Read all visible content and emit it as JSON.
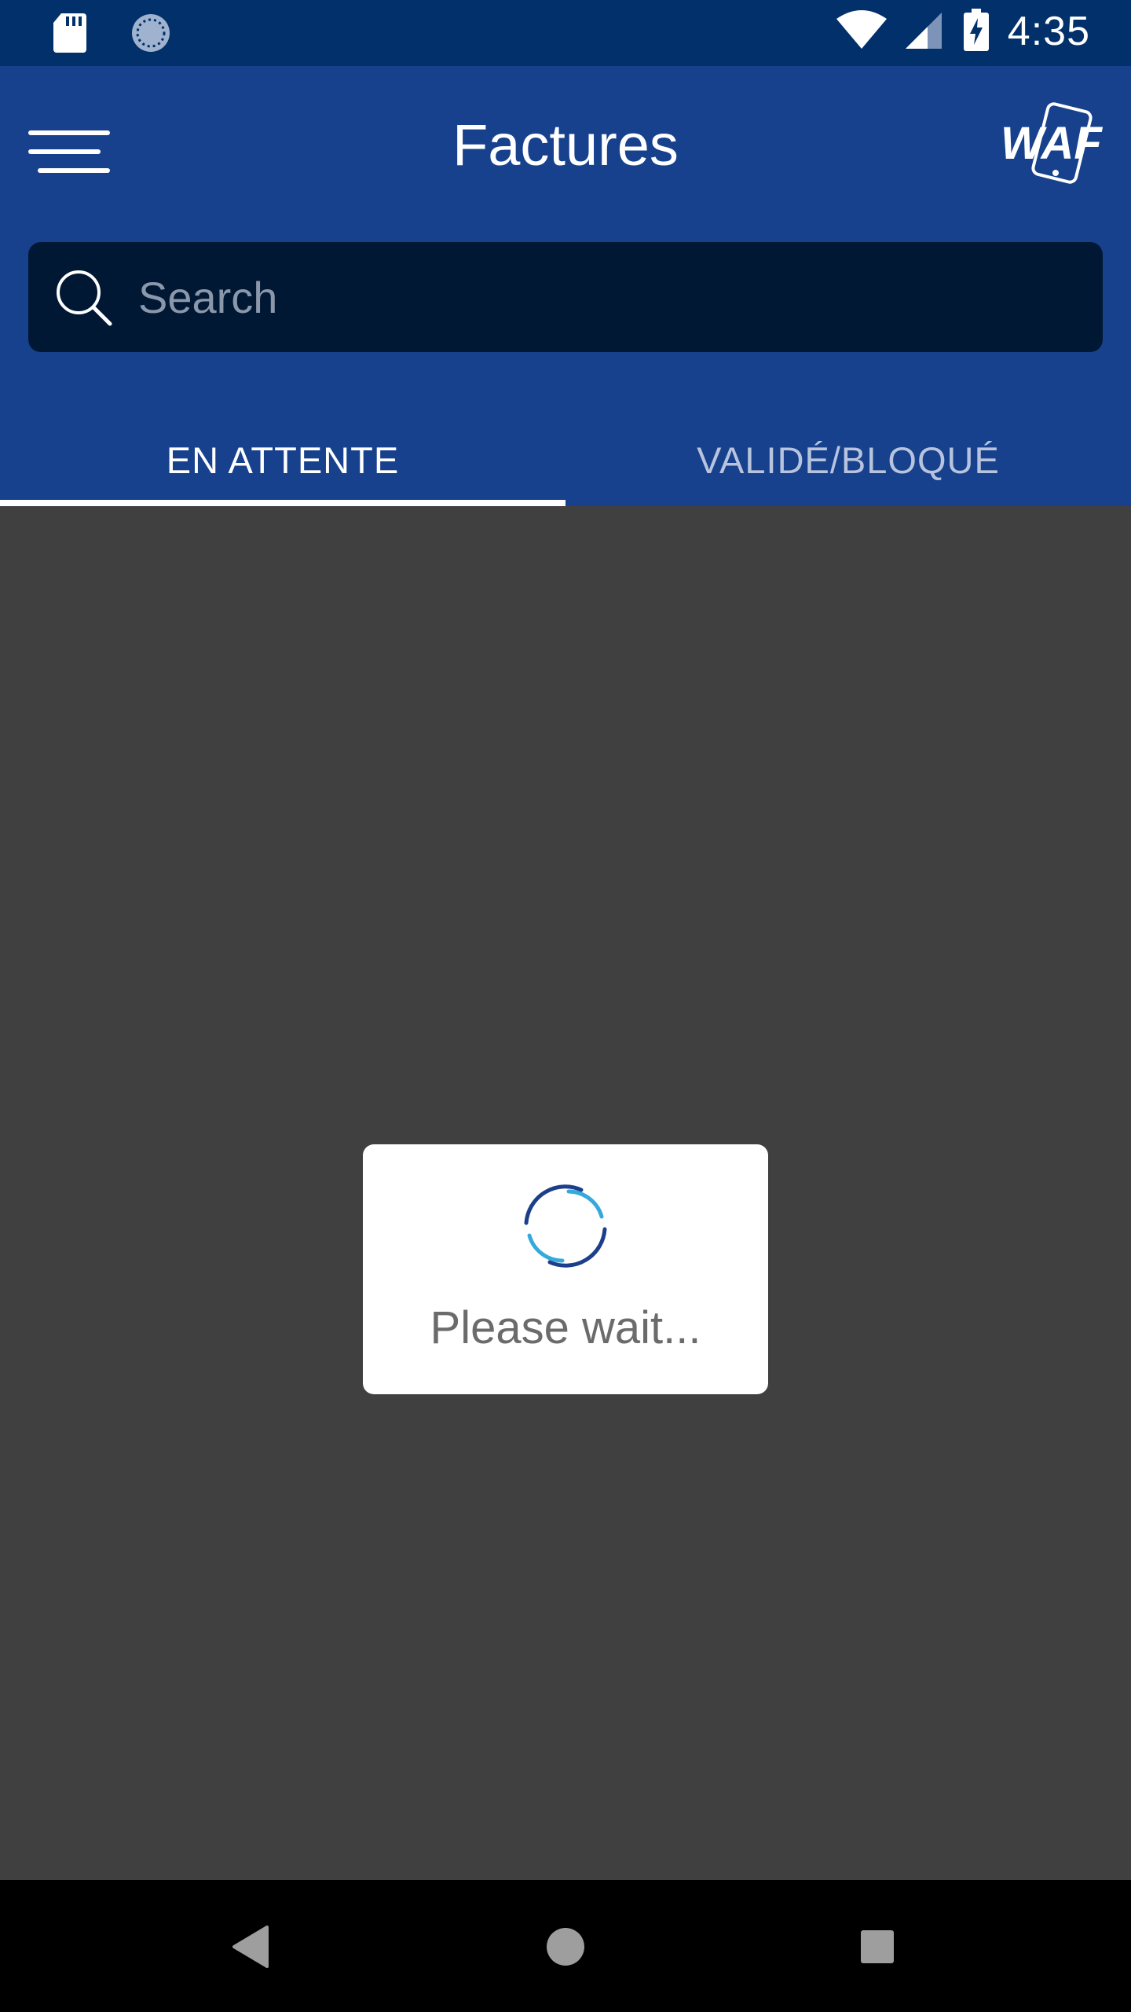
{
  "status_bar": {
    "time": "4:35",
    "icons": [
      "sd-card-icon",
      "sync-icon",
      "wifi-icon",
      "cell-signal-icon",
      "battery-charging-icon"
    ]
  },
  "app_bar": {
    "title": "Factures",
    "menu_icon": "hamburger-menu-icon",
    "logo_text": "WAF"
  },
  "search": {
    "placeholder": "Search",
    "value": ""
  },
  "tabs": [
    {
      "label": "EN ATTENTE",
      "active": true
    },
    {
      "label": "VALIDÉ/BLOQUÉ",
      "active": false
    }
  ],
  "dialog": {
    "message": "Please wait..."
  },
  "nav_bar": {
    "buttons": [
      "back-icon",
      "home-icon",
      "recents-icon"
    ]
  },
  "colors": {
    "status_bar": "#02306a",
    "app_bar": "#17418d",
    "search_bg": "#001834",
    "overlay": "#404040",
    "spinner_dark": "#1c3f8a",
    "spinner_light": "#35a9dc"
  }
}
